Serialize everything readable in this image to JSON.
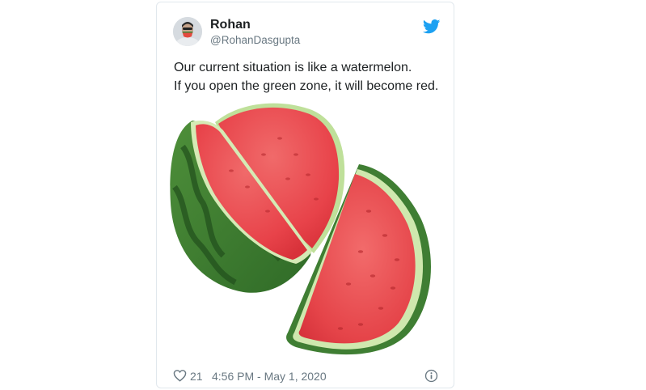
{
  "tweet": {
    "author_name": "Rohan",
    "author_handle": "@RohanDasgupta",
    "text_lines": [
      "Our current situation is like a watermelon.",
      "If you open the green zone, it will become red."
    ],
    "likes": "21",
    "timestamp": "4:56 PM - May 1, 2020",
    "icons": {
      "logo": "twitter-bird-icon",
      "like": "heart-icon",
      "info": "info-icon"
    },
    "colors": {
      "twitter_blue": "#1da1f2",
      "text": "#1c2022",
      "muted": "#697882",
      "border": "#e1e8ed"
    }
  }
}
